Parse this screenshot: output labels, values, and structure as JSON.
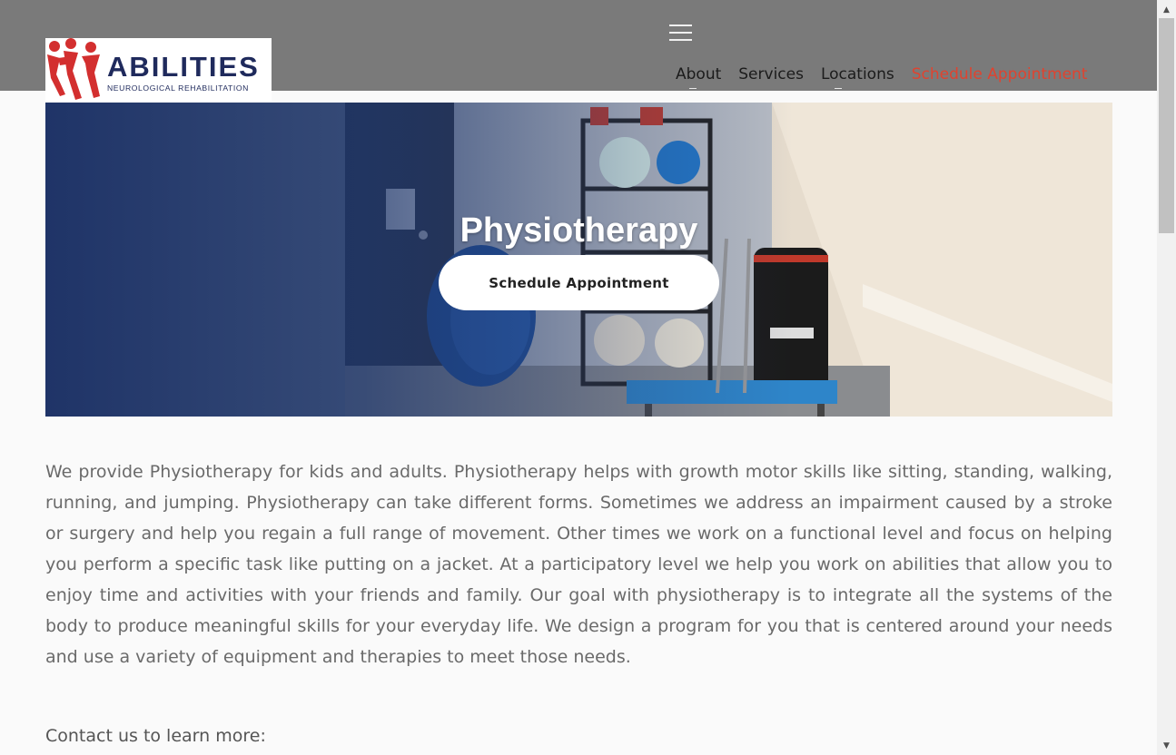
{
  "header": {
    "logo": {
      "name": "ABILITIES",
      "tagline": "NEUROLOGICAL REHABILITATION"
    },
    "nav": [
      {
        "label": "About"
      },
      {
        "label": "Services"
      },
      {
        "label": "Locations"
      },
      {
        "label": "Schedule Appointment"
      }
    ],
    "menu_icon": "hamburger-icon"
  },
  "hero": {
    "title": "Physiotherapy",
    "button_label": "Schedule Appointment"
  },
  "content": {
    "intro": "We provide Physiotherapy for kids and adults. Physiotherapy helps with growth motor skills like sitting, standing, walking, running, and jumping. Physiotherapy can take different forms. Sometimes we address an impairment caused by a stroke or surgery and help you regain a full range of movement. Other times we work on a functional level and focus on helping you perform a specific task like putting on a jacket. At a participatory level we help you work on abilities that allow you to enjoy time and activities with your friends and family. Our goal with physiotherapy is to integrate all the systems of the body to produce meaningful skills for your everyday life. We design a program for you that is centered around your needs and use a variety of equipment and therapies to meet those needs.",
    "contact": "Contact us to learn more:"
  },
  "colors": {
    "header_bg": "#7a7a7a",
    "brand_navy": "#1f2a5c",
    "brand_red": "#d32f2f",
    "cta_red": "#e0432f",
    "body_text": "#6a6a6a"
  },
  "scrollbar": {
    "up_icon": "arrow-up-icon",
    "down_icon": "arrow-down-icon"
  }
}
